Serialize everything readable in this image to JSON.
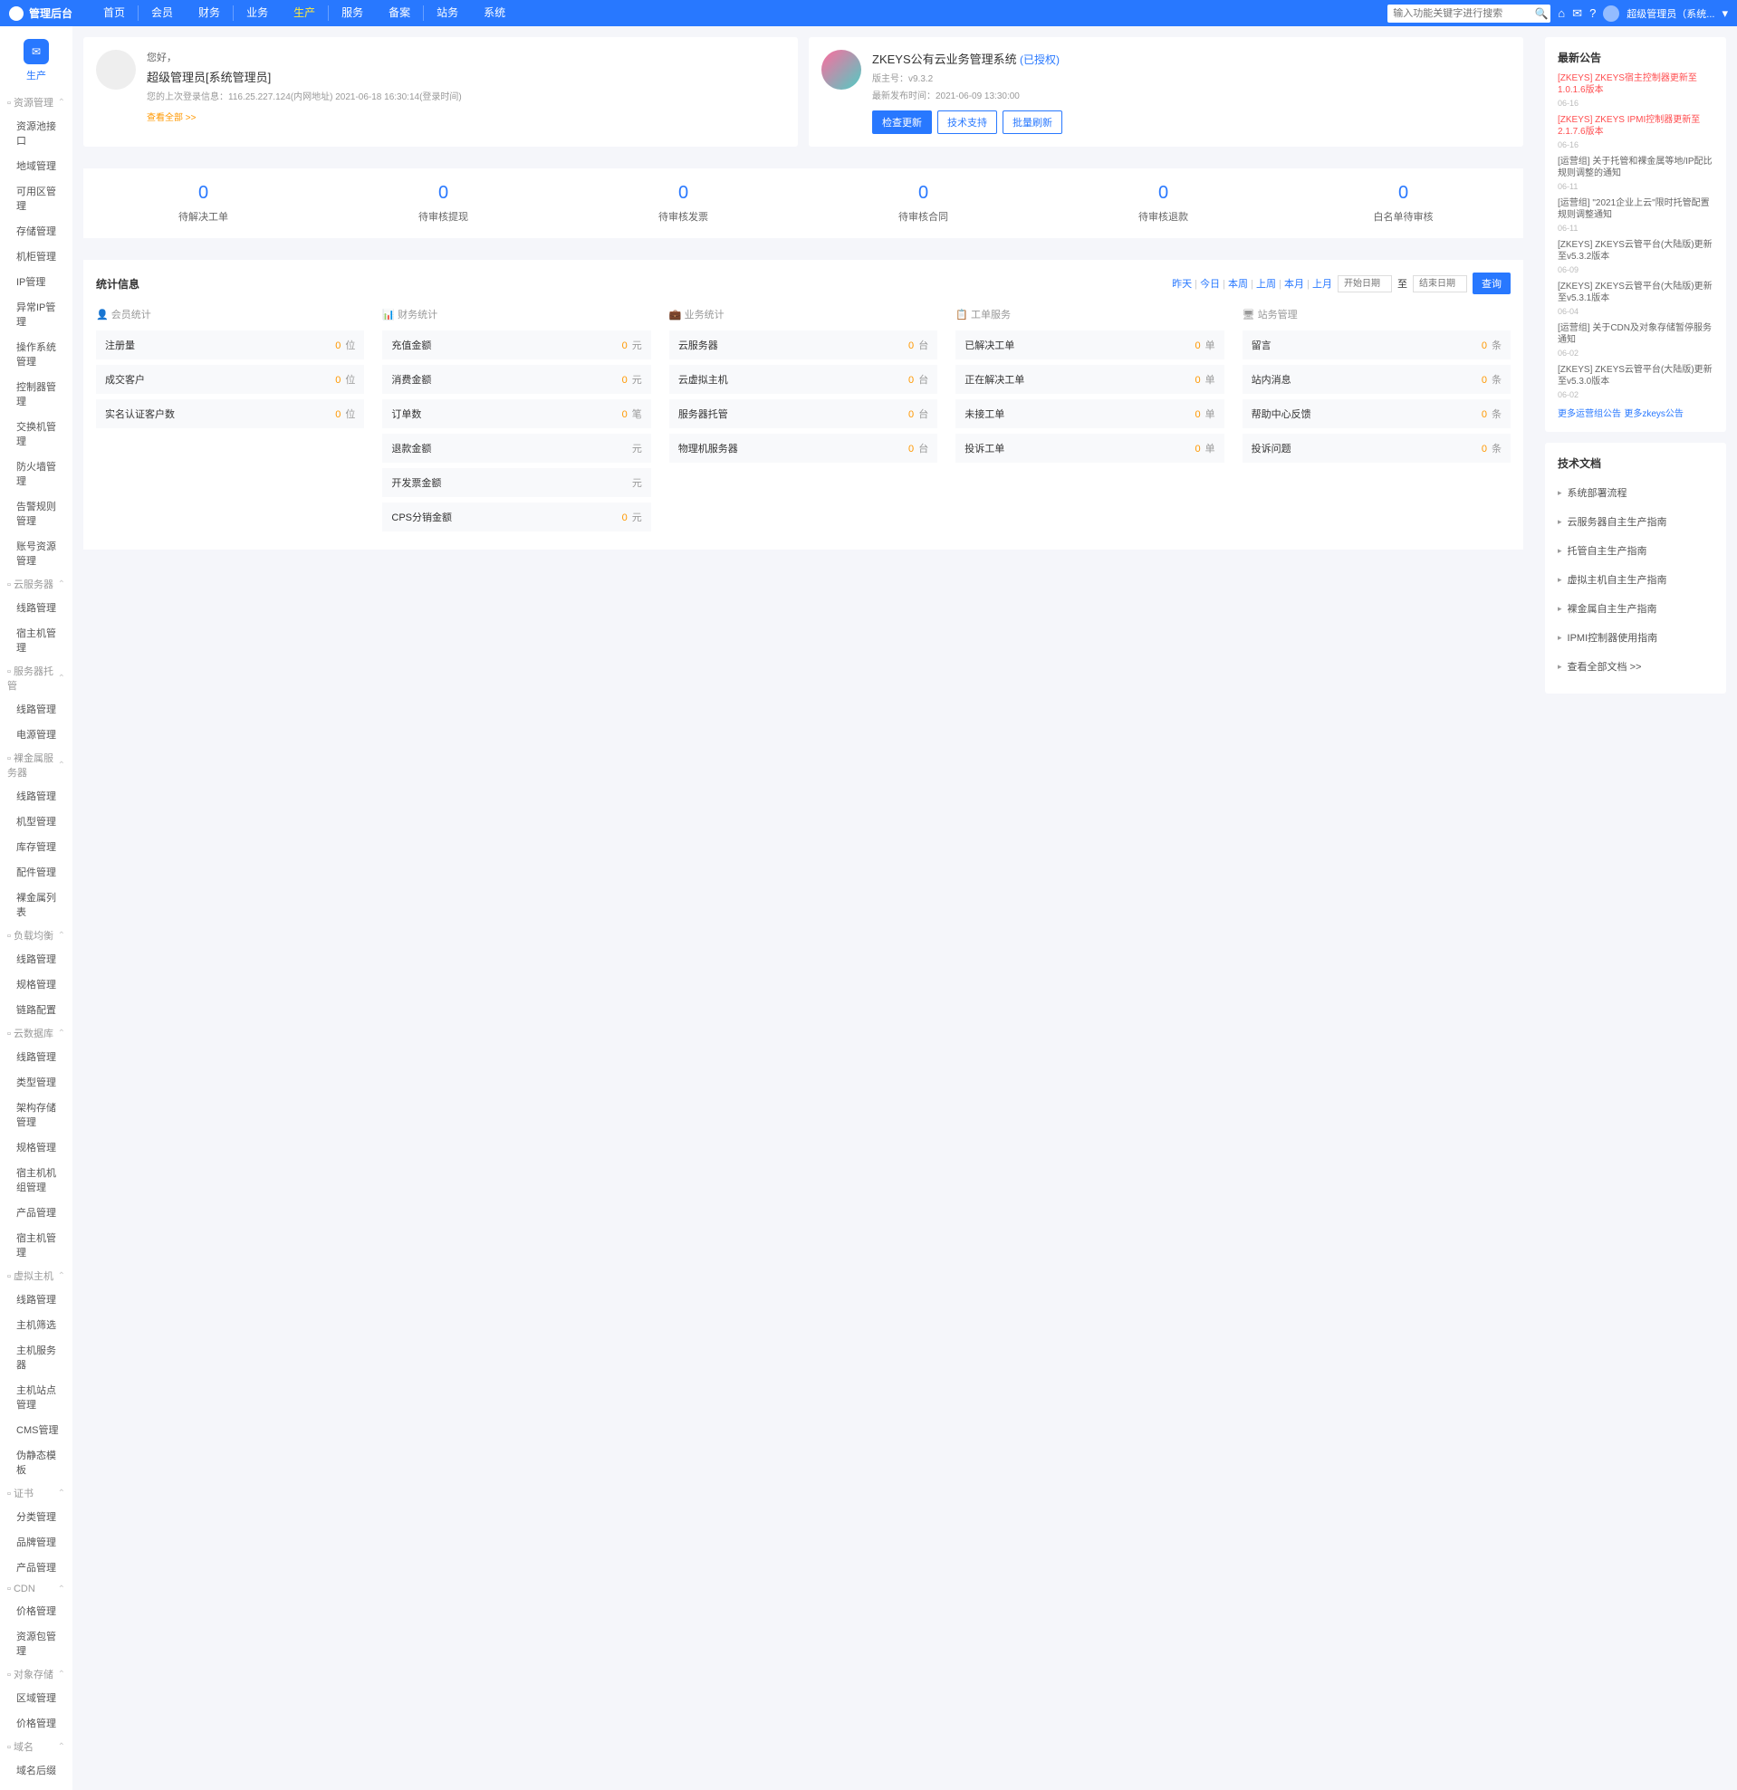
{
  "topbar": {
    "logo": "管理后台",
    "nav": [
      "首页",
      "会员",
      "财务",
      "业务",
      "生产",
      "服务",
      "备案",
      "站务",
      "系统"
    ],
    "active_index": 4,
    "search_placeholder": "输入功能关键字进行搜索",
    "user": "超级管理员（系统..."
  },
  "sidebar": {
    "head": "生产",
    "groups": [
      {
        "label": "资源管理",
        "items": [
          "资源池接口",
          "地域管理",
          "可用区管理",
          "存储管理",
          "机柜管理",
          "IP管理",
          "异常IP管理",
          "操作系统管理",
          "控制器管理",
          "交换机管理",
          "防火墙管理",
          "告警规则管理",
          "账号资源管理"
        ]
      },
      {
        "label": "云服务器",
        "items": [
          "线路管理",
          "宿主机管理"
        ]
      },
      {
        "label": "服务器托管",
        "items": [
          "线路管理",
          "电源管理"
        ]
      },
      {
        "label": "裸金属服务器",
        "items": [
          "线路管理",
          "机型管理",
          "库存管理",
          "配件管理",
          "裸金属列表"
        ]
      },
      {
        "label": "负载均衡",
        "items": [
          "线路管理",
          "规格管理",
          "链路配置"
        ]
      },
      {
        "label": "云数据库",
        "items": [
          "线路管理",
          "类型管理",
          "架构存储管理",
          "规格管理",
          "宿主机机组管理",
          "产品管理",
          "宿主机管理"
        ]
      },
      {
        "label": "虚拟主机",
        "items": [
          "线路管理",
          "主机筛选",
          "主机服务器",
          "主机站点管理",
          "CMS管理",
          "伪静态模板"
        ]
      },
      {
        "label": "证书",
        "items": [
          "分类管理",
          "品牌管理",
          "产品管理"
        ]
      },
      {
        "label": "CDN",
        "items": [
          "价格管理",
          "资源包管理"
        ]
      },
      {
        "label": "对象存储",
        "items": [
          "区域管理",
          "价格管理"
        ]
      },
      {
        "label": "域名",
        "items": [
          "域名后缀"
        ]
      }
    ]
  },
  "welcome": {
    "greet": "您好，",
    "name": "超级管理员[系统管理员]",
    "info": "您的上次登录信息：116.25.227.124(内网地址) 2021-06-18 16:30:14(登录时间)",
    "more": "查看全部 >>"
  },
  "system": {
    "title": "ZKEYS公有云业务管理系统",
    "auth": "(已授权)",
    "version_label": "版主号：",
    "version": "v9.3.2",
    "issue_label": "最新发布时间：",
    "issue": "2021-06-09 13:30:00",
    "btns": [
      "检查更新",
      "技术支持",
      "批量刷新"
    ]
  },
  "notice": {
    "title": "最新公告",
    "items": [
      {
        "text": "[ZKEYS] ZKEYS宿主控制器更新至1.0.1.6版本",
        "date": "06-16",
        "red": true
      },
      {
        "text": "[ZKEYS] ZKEYS IPMI控制器更新至2.1.7.6版本",
        "date": "06-16",
        "red": true
      },
      {
        "text": "[运营组] 关于托管和裸金属等地/IP配比规则调整的通知",
        "date": "06-11"
      },
      {
        "text": "[运营组] \"2021企业上云\"限时托管配置规则调整通知",
        "date": "06-11"
      },
      {
        "text": "[ZKEYS] ZKEYS云管平台(大陆版)更新至v5.3.2版本",
        "date": "06-09"
      },
      {
        "text": "[ZKEYS] ZKEYS云管平台(大陆版)更新至v5.3.1版本",
        "date": "06-04"
      },
      {
        "text": "[运营组] 关于CDN及对象存储暂停服务通知",
        "date": "06-02"
      },
      {
        "text": "[ZKEYS] ZKEYS云管平台(大陆版)更新至v5.3.0版本",
        "date": "06-02"
      }
    ],
    "more1": "更多运营组公告",
    "more2": "更多zkeys公告"
  },
  "pending": [
    {
      "num": "0",
      "label": "待解决工单"
    },
    {
      "num": "0",
      "label": "待审核提现"
    },
    {
      "num": "0",
      "label": "待审核发票"
    },
    {
      "num": "0",
      "label": "待审核合同"
    },
    {
      "num": "0",
      "label": "待审核退款"
    },
    {
      "num": "0",
      "label": "白名单待审核"
    }
  ],
  "stats": {
    "title": "统计信息",
    "filters": [
      "昨天",
      "今日",
      "本周",
      "上周",
      "本月",
      "上月"
    ],
    "date_from": "开始日期",
    "date_to": "结束日期",
    "date_sep": "至",
    "query": "查询",
    "cols": [
      {
        "title": "会员统计",
        "icon": "👤",
        "rows": [
          {
            "label": "注册量",
            "val": "0",
            "unit": "位"
          },
          {
            "label": "成交客户",
            "val": "0",
            "unit": "位"
          },
          {
            "label": "实名认证客户数",
            "val": "0",
            "unit": "位"
          }
        ]
      },
      {
        "title": "财务统计",
        "icon": "📊",
        "rows": [
          {
            "label": "充值金额",
            "val": "0",
            "unit": "元"
          },
          {
            "label": "消费金额",
            "val": "0",
            "unit": "元"
          },
          {
            "label": "订单数",
            "val": "0",
            "unit": "笔"
          },
          {
            "label": "退款金额",
            "val": "",
            "unit": "元"
          },
          {
            "label": "开发票金额",
            "val": "",
            "unit": "元"
          },
          {
            "label": "CPS分销金额",
            "val": "0",
            "unit": "元"
          }
        ]
      },
      {
        "title": "业务统计",
        "icon": "💼",
        "rows": [
          {
            "label": "云服务器",
            "val": "0",
            "unit": "台"
          },
          {
            "label": "云虚拟主机",
            "val": "0",
            "unit": "台"
          },
          {
            "label": "服务器托管",
            "val": "0",
            "unit": "台"
          },
          {
            "label": "物理机服务器",
            "val": "0",
            "unit": "台"
          }
        ]
      },
      {
        "title": "工单服务",
        "icon": "📋",
        "rows": [
          {
            "label": "已解决工单",
            "val": "0",
            "unit": "单"
          },
          {
            "label": "正在解决工单",
            "val": "0",
            "unit": "单"
          },
          {
            "label": "未接工单",
            "val": "0",
            "unit": "单"
          },
          {
            "label": "投诉工单",
            "val": "0",
            "unit": "单"
          }
        ]
      },
      {
        "title": "站务管理",
        "icon": "🖥",
        "rows": [
          {
            "label": "留言",
            "val": "0",
            "unit": "条"
          },
          {
            "label": "站内消息",
            "val": "0",
            "unit": "条"
          },
          {
            "label": "帮助中心反馈",
            "val": "0",
            "unit": "条"
          },
          {
            "label": "投诉问题",
            "val": "0",
            "unit": "条"
          }
        ]
      }
    ]
  },
  "docs": {
    "title": "技术文档",
    "items": [
      "系统部署流程",
      "云服务器自主生产指南",
      "托管自主生产指南",
      "虚拟主机自主生产指南",
      "裸金属自主生产指南",
      "IPMI控制器使用指南"
    ],
    "more": "查看全部文档 >>"
  }
}
